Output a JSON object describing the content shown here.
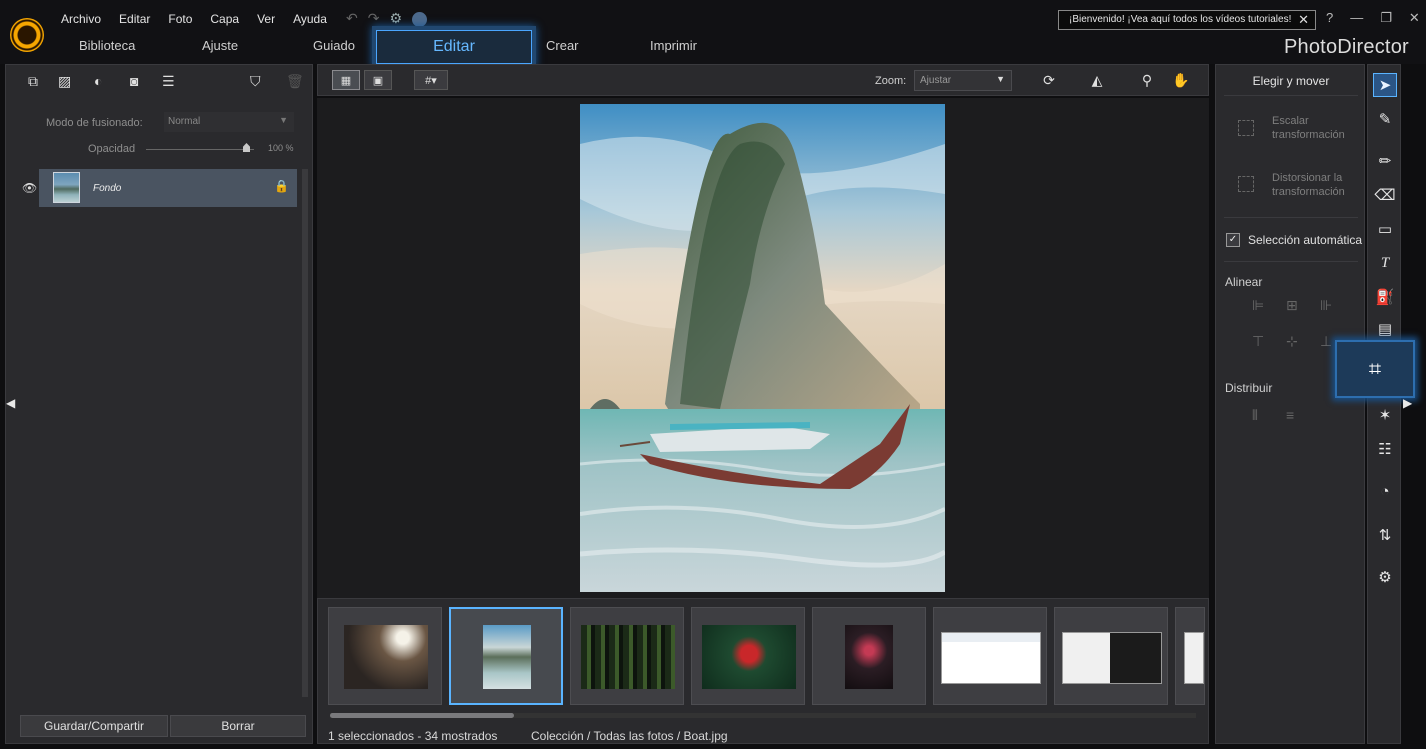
{
  "app": {
    "brand": "PhotoDirector"
  },
  "menu": [
    "Archivo",
    "Editar",
    "Foto",
    "Capa",
    "Ver",
    "Ayuda"
  ],
  "tabs": {
    "biblioteca": "Biblioteca",
    "ajuste": "Ajuste",
    "guiado": "Guiado",
    "editar": "Editar",
    "crear": "Crear",
    "imprimir": "Imprimir"
  },
  "welcome": {
    "text": "¡Bienvenido! ¡Vea aquí todos los vídeos tutoriales!",
    "close": "✕"
  },
  "window_controls": {
    "help": "?",
    "minimize": "—",
    "restore": "❐",
    "close": "✕"
  },
  "layers_panel": {
    "blend_label": "Modo de fusionado:",
    "blend_value": "Normal",
    "opacity_label": "Opacidad",
    "opacity_value": "100 %",
    "opacity_level": 1.0,
    "layer_name": "Fondo",
    "save_button": "Guardar/Compartir",
    "delete_button": "Borrar"
  },
  "viewer": {
    "zoom_label": "Zoom:",
    "zoom_value": "Ajustar"
  },
  "status": {
    "selection": "1 seleccionados - 34 mostrados",
    "path": "Colección / Todas las fotos / Boat.jpg"
  },
  "right_panel": {
    "title": "Elegir y mover",
    "scale": "Escalar transformación",
    "distort": "Distorsionar la transformación",
    "auto_select": "Selección automática",
    "align": "Alinear",
    "distribute": "Distribuir"
  },
  "colors": {
    "accent": "#5ab4ff",
    "panel": "#2a2a2d",
    "background": "#1c1c1e",
    "logo": "#f6a600"
  }
}
